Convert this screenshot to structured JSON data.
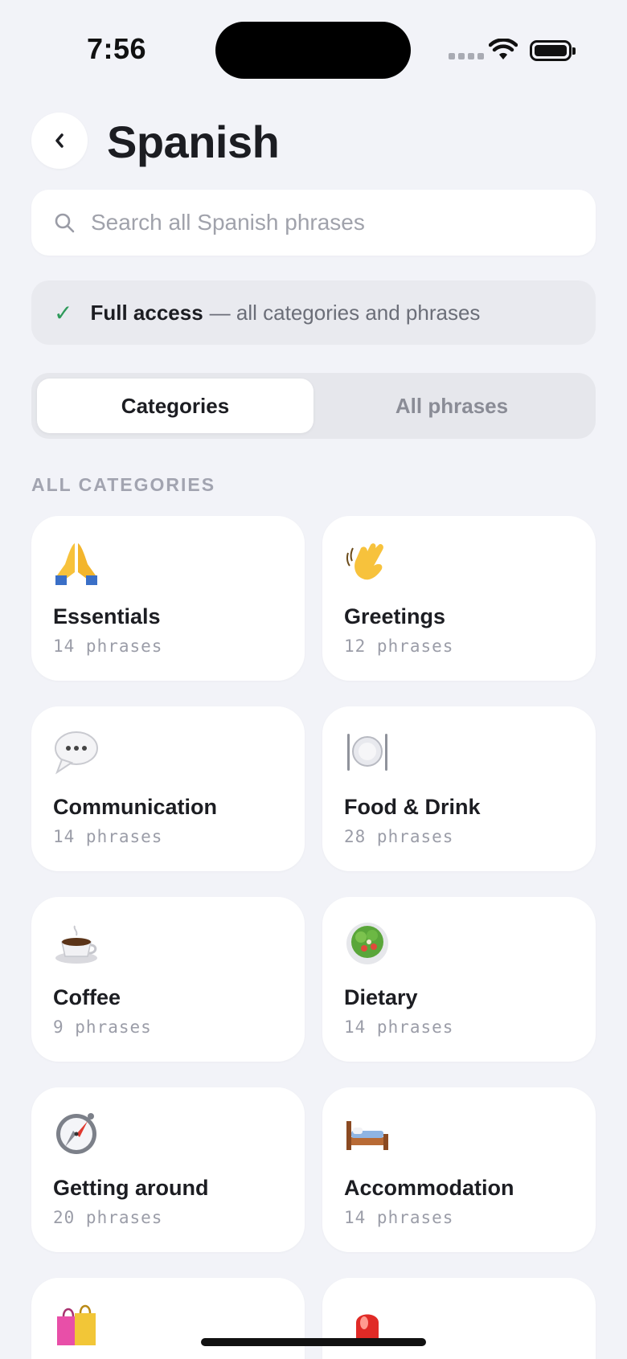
{
  "status_bar": {
    "time": "7:56"
  },
  "header": {
    "title": "Spanish"
  },
  "search": {
    "placeholder": "Search all Spanish phrases"
  },
  "access": {
    "label": "Full access",
    "detail": "— all categories and phrases"
  },
  "tabs": [
    {
      "label": "Categories",
      "active": true
    },
    {
      "label": "All phrases",
      "active": false
    }
  ],
  "section_label": "ALL CATEGORIES",
  "categories": [
    {
      "name": "Essentials",
      "count": "14 phrases",
      "icon": "praying-hands-icon"
    },
    {
      "name": "Greetings",
      "count": "12 phrases",
      "icon": "waving-hand-icon"
    },
    {
      "name": "Communication",
      "count": "14 phrases",
      "icon": "speech-bubble-icon"
    },
    {
      "name": "Food & Drink",
      "count": "28 phrases",
      "icon": "plate-cutlery-icon"
    },
    {
      "name": "Coffee",
      "count": "9 phrases",
      "icon": "coffee-cup-icon"
    },
    {
      "name": "Dietary",
      "count": "14 phrases",
      "icon": "salad-icon"
    },
    {
      "name": "Getting around",
      "count": "20 phrases",
      "icon": "compass-icon"
    },
    {
      "name": "Accommodation",
      "count": "14 phrases",
      "icon": "bed-icon"
    },
    {
      "name": "",
      "count": "",
      "icon": "shopping-bags-icon"
    },
    {
      "name": "",
      "count": "",
      "icon": "siren-icon"
    }
  ],
  "colors": {
    "background": "#f2f3f8",
    "accent_check": "#2e9a5a",
    "card": "#ffffff"
  }
}
